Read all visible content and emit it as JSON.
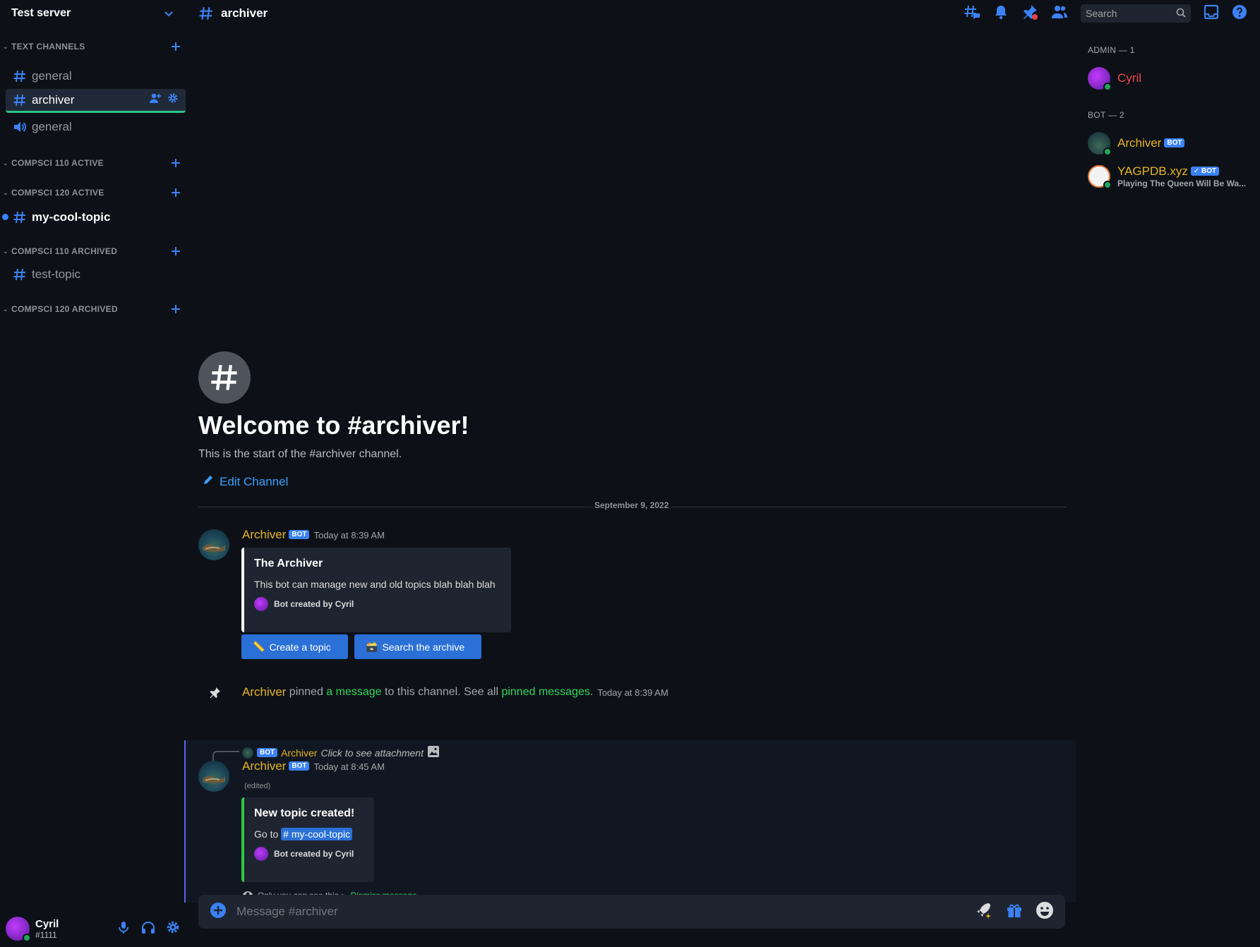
{
  "server": {
    "name": "Test server"
  },
  "sidebar": {
    "categories": [
      {
        "label": "TEXT CHANNELS"
      },
      {
        "label": "COMPSCI 110 ACTIVE"
      },
      {
        "label": "COMPSCI 120 ACTIVE"
      },
      {
        "label": "COMPSCI 110 ARCHIVED"
      },
      {
        "label": "COMPSCI 120 ARCHIVED"
      }
    ],
    "channels": [
      {
        "label": "general",
        "kind": "text"
      },
      {
        "label": "archiver",
        "kind": "text",
        "active": true
      },
      {
        "label": "general",
        "kind": "voice"
      },
      {
        "label": "my-cool-topic",
        "kind": "text",
        "unread": true
      },
      {
        "label": "test-topic",
        "kind": "text"
      }
    ]
  },
  "user": {
    "name": "Cyril",
    "tag": "#1111"
  },
  "topbar": {
    "channel": "archiver",
    "search_placeholder": "Search"
  },
  "welcome": {
    "title": "Welcome to #archiver!",
    "subtitle": "This is the start of the #archiver channel.",
    "edit_label": "Edit Channel"
  },
  "date_divider": "September 9, 2022",
  "messages": {
    "first": {
      "author": "Archiver",
      "bot_tag": "BOT",
      "timestamp": "Today at 8:39 AM",
      "embed": {
        "title": "The Archiver",
        "description": "This bot can manage new and old topics blah blah blah",
        "footer": "Bot created by Cyril"
      },
      "buttons": [
        {
          "label": "Create a topic",
          "emoji": "📏"
        },
        {
          "label": "Search the archive",
          "emoji": "🗃️"
        }
      ]
    },
    "pin": {
      "author": "Archiver",
      "text_pinned": " pinned ",
      "link_message": "a message",
      "text_mid": " to this channel. See all ",
      "link_pinned": "pinned messages",
      "text_end": ".",
      "timestamp": "Today at 8:39 AM"
    },
    "second": {
      "reply": {
        "bot_tag": "BOT",
        "author": "Archiver",
        "text": "Click to see attachment"
      },
      "author": "Archiver",
      "bot_tag": "BOT",
      "timestamp": "Today at 8:45 AM",
      "edited": "(edited)",
      "embed": {
        "title": "New topic created!",
        "go_to": "Go to ",
        "channel_mention": "my-cool-topic",
        "footer": "Bot created by Cyril"
      },
      "notice": "Only you can see this • ",
      "dismiss": "Dismiss message"
    }
  },
  "composer": {
    "placeholder": "Message #archiver"
  },
  "members": {
    "groups": [
      {
        "label": "ADMIN — 1"
      },
      {
        "label": "BOT — 2"
      }
    ],
    "list": [
      {
        "name": "Cyril",
        "color": "#f04747"
      },
      {
        "name": "Archiver",
        "color": "#e6b422",
        "badge": "BOT"
      },
      {
        "name": "YAGPDB.xyz",
        "color": "#e6b422",
        "badge": "✓ BOT",
        "status": "Playing The Queen Will Be Wa..."
      }
    ]
  },
  "colors": {
    "accent": "#3b82f6",
    "online": "#23a55a",
    "bot_name": "#e6b422",
    "admin_name": "#f04747",
    "link_green": "#34d65c"
  }
}
